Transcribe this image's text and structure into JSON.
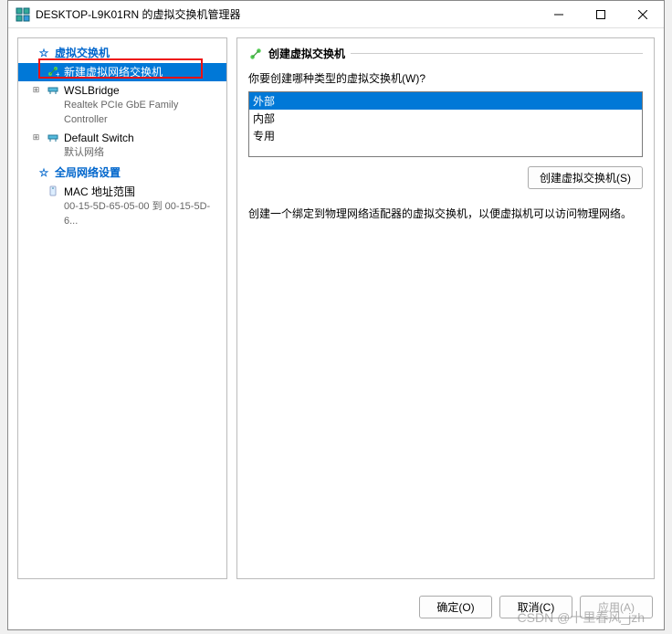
{
  "window": {
    "title": "DESKTOP-L9K01RN 的虚拟交换机管理器"
  },
  "tree": {
    "section1": "虚拟交换机",
    "new_switch": "新建虚拟网络交换机",
    "wsl": {
      "name": "WSLBridge",
      "detail": "Realtek PCIe GbE Family Controller"
    },
    "default_switch": {
      "name": "Default Switch",
      "detail": "默认网络"
    },
    "section2": "全局网络设置",
    "mac": {
      "name": "MAC 地址范围",
      "detail": "00-15-5D-65-05-00 到 00-15-5D-6..."
    }
  },
  "right": {
    "header": "创建虚拟交换机",
    "question": "你要创建哪种类型的虚拟交换机(W)?",
    "options": {
      "external": "外部",
      "internal": "内部",
      "private": "专用"
    },
    "create_btn": "创建虚拟交换机(S)",
    "description": "创建一个绑定到物理网络适配器的虚拟交换机，以便虚拟机可以访问物理网络。"
  },
  "footer": {
    "ok": "确定(O)",
    "cancel": "取消(C)",
    "apply": "应用(A)"
  },
  "watermark": "CSDN @十里春风_jzh"
}
